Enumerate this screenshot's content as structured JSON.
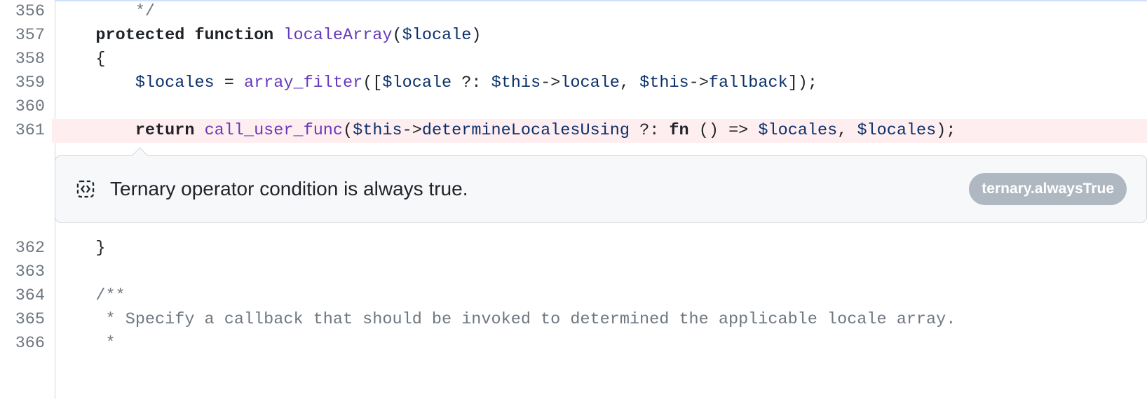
{
  "lines": {
    "356": {
      "num": "356"
    },
    "357": {
      "num": "357"
    },
    "358": {
      "num": "358"
    },
    "359": {
      "num": "359"
    },
    "360": {
      "num": "360"
    },
    "361": {
      "num": "361"
    },
    "362": {
      "num": "362"
    },
    "363": {
      "num": "363"
    },
    "364": {
      "num": "364"
    },
    "365": {
      "num": "365"
    },
    "366": {
      "num": "366"
    }
  },
  "tokens": {
    "l356_close": "*/",
    "l357_protected": "protected",
    "l357_function": "function",
    "l357_name": "localeArray",
    "l357_open": "(",
    "l357_param": "$locale",
    "l357_close": ")",
    "l358_brace": "{",
    "l359_var": "$locales",
    "l359_eq": " = ",
    "l359_fn": "array_filter",
    "l359_open": "([",
    "l359_p1": "$locale",
    "l359_tern": " ?: ",
    "l359_this1": "$this",
    "l359_arrow1": "->",
    "l359_m1": "locale",
    "l359_comma": ", ",
    "l359_this2": "$this",
    "l359_arrow2": "->",
    "l359_m2": "fallback",
    "l359_close": "]);",
    "l361_return": "return",
    "l361_fn": "call_user_func",
    "l361_open": "(",
    "l361_this": "$this",
    "l361_arrow": "->",
    "l361_m": "determineLocalesUsing",
    "l361_tern": " ?: ",
    "l361_fn_kw": "fn",
    "l361_fn_paren": " () ",
    "l361_fn_arrow": "=>",
    "l361_sp": " ",
    "l361_v1": "$locales",
    "l361_comma": ", ",
    "l361_v2": "$locales",
    "l361_close": ");",
    "l362_brace": "}",
    "l364_open": "/**",
    "l365_body": " * Specify a callback that should be invoked to determined the applicable locale array.",
    "l366_star": " *"
  },
  "indent": {
    "i8": "        ",
    "i4": "    ",
    "i3": "   "
  },
  "annotation": {
    "message": "Ternary operator condition is always true.",
    "badge": "ternary.alwaysTrue"
  }
}
